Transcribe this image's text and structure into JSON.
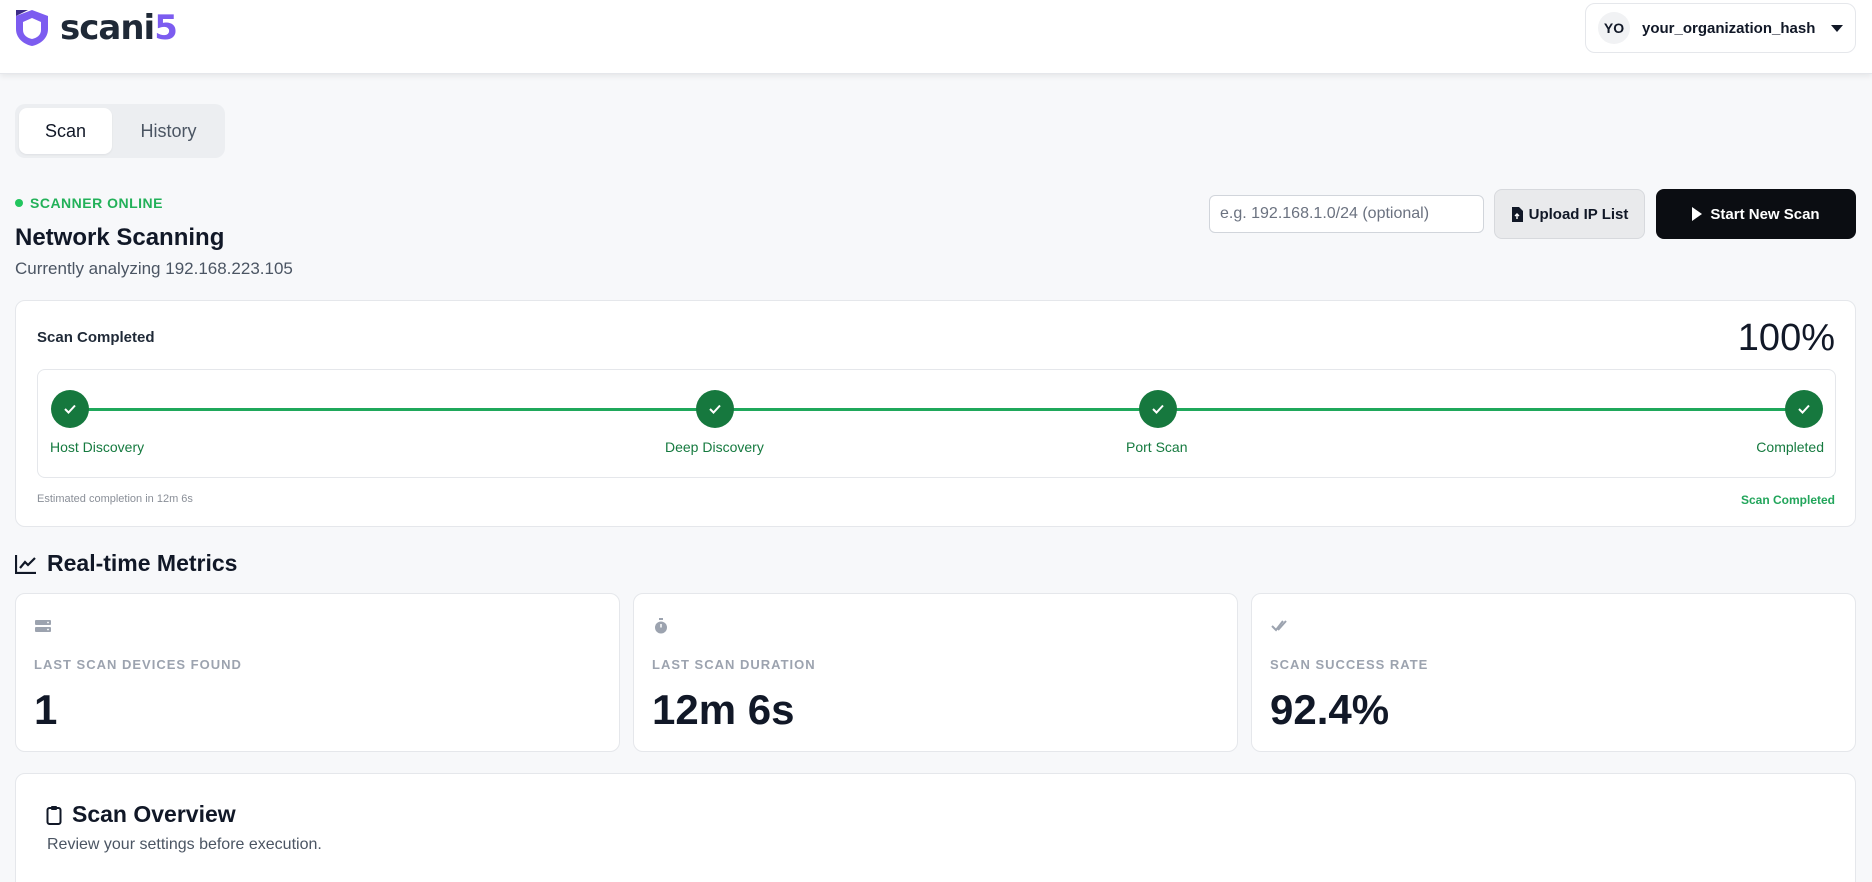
{
  "header": {
    "logo_text_main": "scani",
    "logo_text_accent": "5",
    "org_initials": "YO",
    "org_name": "your_organization_hash"
  },
  "tabs": [
    {
      "label": "Scan",
      "active": true
    },
    {
      "label": "History",
      "active": false
    }
  ],
  "scanner": {
    "status": "SCANNER ONLINE",
    "title": "Network Scanning",
    "subtitle": "Currently analyzing 192.168.223.105"
  },
  "actions": {
    "ip_placeholder": "e.g. 192.168.1.0/24 (optional)",
    "upload_label": "Upload IP List",
    "start_label": "Start New Scan"
  },
  "progress": {
    "title": "Scan Completed",
    "percent_text": "100%",
    "percent_value": 100,
    "steps": [
      {
        "label": "Host Discovery",
        "done": true
      },
      {
        "label": "Deep Discovery",
        "done": true
      },
      {
        "label": "Port Scan",
        "done": true
      },
      {
        "label": "Completed",
        "done": true
      }
    ],
    "eta": "Estimated completion in 12m 6s",
    "status_note": "Scan Completed"
  },
  "metrics": {
    "title": "Real-time Metrics",
    "cards": [
      {
        "icon": "server-icon",
        "label": "LAST SCAN DEVICES FOUND",
        "value": "1"
      },
      {
        "icon": "stopwatch-icon",
        "label": "LAST SCAN DURATION",
        "value": "12m 6s"
      },
      {
        "icon": "double-check-icon",
        "label": "SCAN SUCCESS RATE",
        "value": "92.4%"
      }
    ]
  },
  "overview": {
    "title": "Scan Overview",
    "subtitle": "Review your settings before execution."
  },
  "colors": {
    "brand": "#7c5cf0",
    "success": "#16783e",
    "success_line": "#1fa85b",
    "primary_button": "#0b0d12"
  }
}
